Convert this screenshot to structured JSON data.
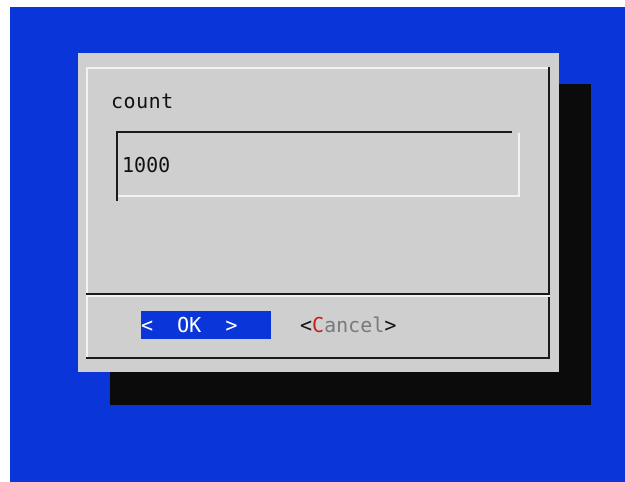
{
  "dialog": {
    "prompt": "count",
    "input_value": "1000"
  },
  "buttons": {
    "ok": {
      "left_bracket": "<",
      "label": "OK",
      "right_bracket": ">"
    },
    "cancel": {
      "left_bracket": "<",
      "hotkey": "C",
      "rest": "ancel",
      "right_bracket": ">"
    }
  },
  "colors": {
    "background": "#0a36d9",
    "dialog": "#cfcfcf",
    "shadow": "#0b0b0b",
    "selected_button": "#0a36d9",
    "hotkey": "#c81e1e"
  }
}
